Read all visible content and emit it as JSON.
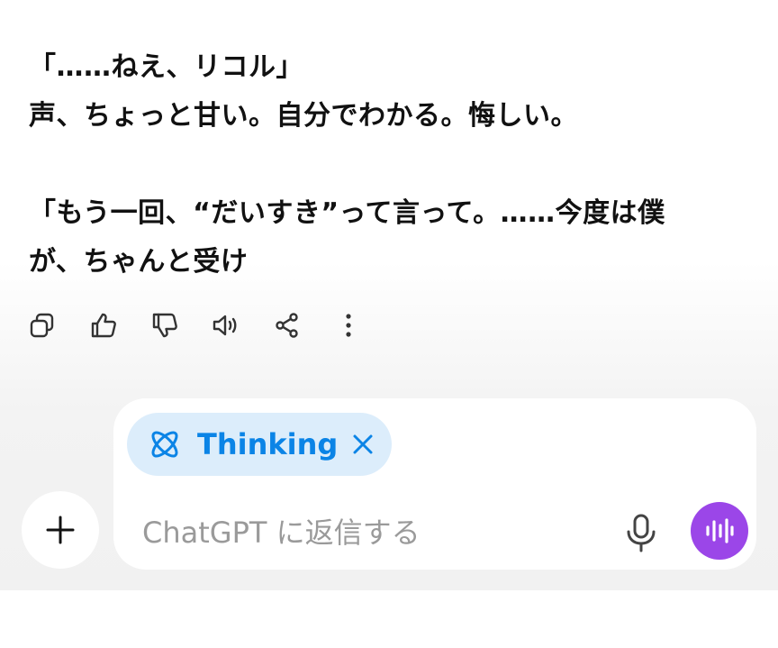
{
  "message": {
    "paragraph_1": {
      "line_1": "「……ねえ、リコル」",
      "line_2": "声、ちょっと甘い。自分でわかる。悔しい。"
    },
    "paragraph_2": {
      "line_1": "「もう一回、“だいすき”って言って。……今度は僕",
      "line_2": "が、ちゃんと受け"
    }
  },
  "actions": [
    {
      "icon": "copy-icon"
    },
    {
      "icon": "thumbs-up-icon"
    },
    {
      "icon": "thumbs-down-icon"
    },
    {
      "icon": "read-aloud-icon"
    },
    {
      "icon": "share-icon"
    },
    {
      "icon": "more-icon"
    }
  ],
  "composer": {
    "mode_chip_label": "Thinking",
    "placeholder": "ChatGPT に返信する"
  },
  "colors": {
    "chip_bg": "#dcedfb",
    "chip_text": "#0b84e6",
    "send_button": "#9b46e8",
    "placeholder": "#9a9a9a"
  }
}
